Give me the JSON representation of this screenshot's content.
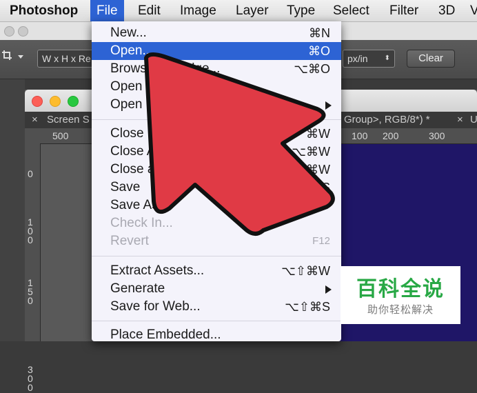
{
  "menubar": {
    "app_name": "Photoshop",
    "items": [
      "File",
      "Edit",
      "Image",
      "Layer",
      "Type",
      "Select",
      "Filter",
      "3D",
      "V"
    ]
  },
  "options_bar": {
    "size_field": "W x H x Re",
    "unit_field": "px/in",
    "clear_button": "Clear"
  },
  "document": {
    "tab_left": "Screen S",
    "tab_right_text": "Group>, RGB/8*) *",
    "tab_right_close": "×",
    "tab_far_right": "U",
    "ruler_top": [
      "500",
      "100",
      "200",
      "300"
    ],
    "ruler_left": [
      "0",
      "100",
      "150",
      "300"
    ]
  },
  "file_menu": {
    "items": [
      {
        "label": "New...",
        "shortcut": "⌘N"
      },
      {
        "label": "Open...",
        "shortcut": "⌘O",
        "highlighted": true
      },
      {
        "label": "Browse in Bridge...",
        "shortcut": "⌥⌘O"
      },
      {
        "label": "Open as Smart Object",
        "shortcut": ""
      },
      {
        "label": "Open Recent",
        "shortcut": "",
        "submenu": true
      },
      {
        "label": "Close",
        "shortcut": "⌘W"
      },
      {
        "label": "Close All",
        "shortcut": "⌥⌘W"
      },
      {
        "label": "Close and Go to Bridge...",
        "shortcut": "⇧⌘W"
      },
      {
        "label": "Save",
        "shortcut": "⌘S"
      },
      {
        "label": "Save As...",
        "shortcut": ""
      },
      {
        "label": "Check In...",
        "shortcut": "",
        "disabled": true
      },
      {
        "label": "Revert",
        "shortcut": "F12",
        "disabled": true
      },
      {
        "label": "Extract Assets...",
        "shortcut": "⌥⇧⌘W"
      },
      {
        "label": "Generate",
        "shortcut": "",
        "submenu": true
      },
      {
        "label": "Save for Web...",
        "shortcut": "⌥⇧⌘S"
      },
      {
        "label": "Place Embedded...",
        "shortcut": ""
      }
    ]
  },
  "watermark": {
    "title": "百科全说",
    "subtitle": "助你轻松解决"
  },
  "colors": {
    "highlight": "#2d63d4",
    "arrow_red": "#e03a45",
    "canvas_blue": "#1f1667",
    "watermark_green": "#28a845"
  }
}
